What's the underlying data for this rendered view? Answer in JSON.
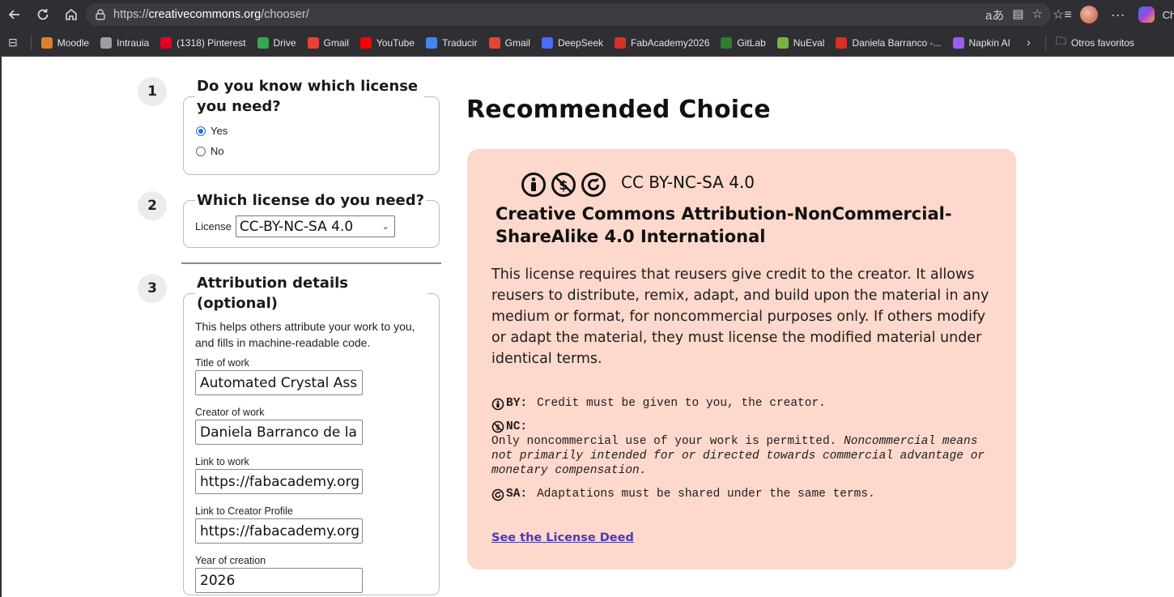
{
  "browser": {
    "url_prefix": "https://",
    "url_host": "creativecommons.org",
    "url_path": "/chooser/",
    "profile_label": "Ch"
  },
  "bookmarks": [
    {
      "label": "Moodle",
      "color": "#d9822b"
    },
    {
      "label": "Intrauia",
      "color": "#9aa0a6"
    },
    {
      "label": "(1318) Pinterest",
      "color": "#e60023"
    },
    {
      "label": "Drive",
      "color": "#34a853"
    },
    {
      "label": "Gmail",
      "color": "#ea4335"
    },
    {
      "label": "YouTube",
      "color": "#ff0000"
    },
    {
      "label": "Traducir",
      "color": "#4285f4"
    },
    {
      "label": "Gmail",
      "color": "#ea4335"
    },
    {
      "label": "DeepSeek",
      "color": "#4d6bfe"
    },
    {
      "label": "FabAcademy2026",
      "color": "#d93025"
    },
    {
      "label": "GitLab",
      "color": "#2e7d32"
    },
    {
      "label": "NuEval",
      "color": "#7cb342"
    },
    {
      "label": "Daniela Barranco -...",
      "color": "#d93025"
    },
    {
      "label": "Napkin AI",
      "color": "#9c5cf5"
    }
  ],
  "bookmarks_other": "Otros favoritos",
  "steps": {
    "step1": {
      "number": "1",
      "legend": "Do you know which license you need?",
      "options": [
        "Yes",
        "No"
      ],
      "selected": "Yes"
    },
    "step2": {
      "number": "2",
      "legend": "Which license do you need?",
      "field_label": "License",
      "value": "CC-BY-NC-SA 4.0"
    },
    "step3": {
      "number": "3",
      "legend": "Attribution details (optional)",
      "help": "This helps others attribute your work to you, and fills in machine-readable code.",
      "fields": [
        {
          "label": "Title of work",
          "value": "Automated Crystal Ass"
        },
        {
          "label": "Creator of work",
          "value": "Daniela Barranco de la"
        },
        {
          "label": "Link to work",
          "value": "https://fabacademy.org"
        },
        {
          "label": "Link to Creator Profile",
          "value": "https://fabacademy.org"
        },
        {
          "label": "Year of creation",
          "value": "2026"
        }
      ]
    }
  },
  "recommendation": {
    "heading": "Recommended Choice",
    "short_name": "CC BY-NC-SA 4.0",
    "long_name": "Creative Commons Attribution-NonCommercial-ShareAlike 4.0 International",
    "description": "This license requires that reusers give credit to the creator. It allows reusers to distribute, remix, adapt, and build upon the material in any medium or format, for noncommercial purposes only. If others modify or adapt the material, they must license the modified material under identical terms.",
    "terms": {
      "by_code": "BY:",
      "by_text": "Credit must be given to you, the creator.",
      "nc_code": "NC:",
      "nc_text": "Only noncommercial use of your work is permitted.",
      "nc_note": "Noncommercial means not primarily intended for or directed towards commercial advantage or monetary compensation.",
      "sa_code": "SA:",
      "sa_text": "Adaptations must be shared under the same terms."
    },
    "deed_link": "See the License Deed",
    "box_color": "#fdd8cc"
  }
}
